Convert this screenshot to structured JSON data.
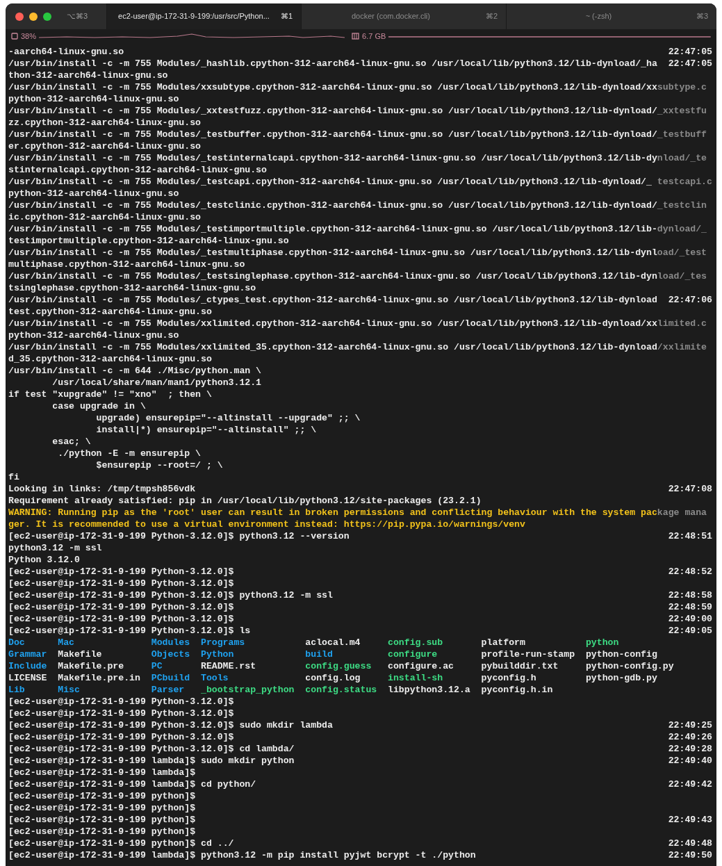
{
  "window": {
    "shortcut": "⌥⌘3"
  },
  "tabs": [
    {
      "label": "ec2-user@ip-172-31-9-199:/usr/src/Python...",
      "shortcut": "⌘1",
      "selected": true
    },
    {
      "label": "docker (com.docker.cli)",
      "shortcut": "⌘2",
      "selected": false
    },
    {
      "label": "~ (-zsh)",
      "shortcut": "⌘3",
      "selected": false
    }
  ],
  "status_bar": {
    "cpu": "38%",
    "memory": "6.7 GB"
  },
  "lines": [
    {
      "kind": "normal",
      "text": "-aarch64-linux-gnu.so",
      "time": "22:47:05"
    },
    {
      "kind": "normal",
      "text": "/usr/bin/install -c -m 755 Modules/_hashlib.cpython-312-aarch64-linux-gnu.so /usr/local/lib/python3.12/lib-dynload/_ha",
      "time": "22:47:05"
    },
    {
      "kind": "normal",
      "text": "thon-312-aarch64-linux-gnu.so"
    },
    {
      "kind": "normal",
      "text": "/usr/bin/install -c -m 755 Modules/xxsubtype.cpython-312-aarch64-linux-gnu.so /usr/local/lib/python3.12/lib-dynload/xx",
      "faded": "subtype.c"
    },
    {
      "kind": "normal",
      "text": "python-312-aarch64-linux-gnu.so"
    },
    {
      "kind": "normal",
      "text": "/usr/bin/install -c -m 755 Modules/_xxtestfuzz.cpython-312-aarch64-linux-gnu.so /usr/local/lib/python3.12/lib-dynload/",
      "faded": "_xxtestfu"
    },
    {
      "kind": "normal",
      "text": "zz.cpython-312-aarch64-linux-gnu.so"
    },
    {
      "kind": "normal",
      "text": "/usr/bin/install -c -m 755 Modules/_testbuffer.cpython-312-aarch64-linux-gnu.so /usr/local/lib/python3.12/lib-dynload/",
      "faded": "_testbuff"
    },
    {
      "kind": "normal",
      "text": "er.cpython-312-aarch64-linux-gnu.so"
    },
    {
      "kind": "normal",
      "text": "/usr/bin/install -c -m 755 Modules/_testinternalcapi.cpython-312-aarch64-linux-gnu.so /usr/local/lib/python3.12/lib-dy",
      "faded": "nload/_te"
    },
    {
      "kind": "normal",
      "text": "stinternalcapi.cpython-312-aarch64-linux-gnu.so"
    },
    {
      "kind": "normal",
      "text": "/usr/bin/install -c -m 755 Modules/_testcapi.cpython-312-aarch64-linux-gnu.so /usr/local/lib/python3.12/lib-dynload/_",
      "faded": "testcapi.c"
    },
    {
      "kind": "normal",
      "text": "python-312-aarch64-linux-gnu.so"
    },
    {
      "kind": "normal",
      "text": "/usr/bin/install -c -m 755 Modules/_testclinic.cpython-312-aarch64-linux-gnu.so /usr/local/lib/python3.12/lib-dynload/",
      "faded": "_testclin"
    },
    {
      "kind": "normal",
      "text": "ic.cpython-312-aarch64-linux-gnu.so"
    },
    {
      "kind": "normal",
      "text": "/usr/bin/install -c -m 755 Modules/_testimportmultiple.cpython-312-aarch64-linux-gnu.so /usr/local/lib/python3.12/lib-",
      "faded": "dynload/_"
    },
    {
      "kind": "normal",
      "text": "testimportmultiple.cpython-312-aarch64-linux-gnu.so"
    },
    {
      "kind": "normal",
      "text": "/usr/bin/install -c -m 755 Modules/_testmultiphase.cpython-312-aarch64-linux-gnu.so /usr/local/lib/python3.12/lib-dynl",
      "faded": "oad/_test"
    },
    {
      "kind": "normal",
      "text": "multiphase.cpython-312-aarch64-linux-gnu.so"
    },
    {
      "kind": "normal",
      "text": "/usr/bin/install -c -m 755 Modules/_testsinglephase.cpython-312-aarch64-linux-gnu.so /usr/local/lib/python3.12/lib-dyn",
      "faded": "load/_tes"
    },
    {
      "kind": "normal",
      "text": "tsinglephase.cpython-312-aarch64-linux-gnu.so"
    },
    {
      "kind": "normal",
      "text": "/usr/bin/install -c -m 755 Modules/_ctypes_test.cpython-312-aarch64-linux-gnu.so /usr/local/lib/python3.12/lib-dynload",
      "time": "22:47:06"
    },
    {
      "kind": "normal",
      "text": "test.cpython-312-aarch64-linux-gnu.so"
    },
    {
      "kind": "normal",
      "text": "/usr/bin/install -c -m 755 Modules/xxlimited.cpython-312-aarch64-linux-gnu.so /usr/local/lib/python3.12/lib-dynload/xx",
      "faded": "limited.c"
    },
    {
      "kind": "normal",
      "text": "python-312-aarch64-linux-gnu.so"
    },
    {
      "kind": "normal",
      "text": "/usr/bin/install -c -m 755 Modules/xxlimited_35.cpython-312-aarch64-linux-gnu.so /usr/local/lib/python3.12/lib-dynload",
      "faded": "/xxlimite"
    },
    {
      "kind": "normal",
      "text": "d_35.cpython-312-aarch64-linux-gnu.so"
    },
    {
      "kind": "normal",
      "text": "/usr/bin/install -c -m 644 ./Misc/python.man \\"
    },
    {
      "kind": "normal",
      "text": "        /usr/local/share/man/man1/python3.12.1"
    },
    {
      "kind": "normal",
      "text": "if test \"xupgrade\" != \"xno\"  ; then \\"
    },
    {
      "kind": "normal",
      "text": "        case upgrade in \\"
    },
    {
      "kind": "normal",
      "text": "                upgrade) ensurepip=\"--altinstall --upgrade\" ;; \\"
    },
    {
      "kind": "normal",
      "text": "                install|*) ensurepip=\"--altinstall\" ;; \\"
    },
    {
      "kind": "normal",
      "text": "        esac; \\"
    },
    {
      "kind": "normal",
      "text": "         ./python -E -m ensurepip \\"
    },
    {
      "kind": "normal",
      "text": "                $ensurepip --root=/ ; \\"
    },
    {
      "kind": "normal",
      "text": "fi"
    },
    {
      "kind": "normal",
      "text": "Looking in links: /tmp/tmpsh856vdk",
      "time": "22:47:08"
    },
    {
      "kind": "normal",
      "text": "Requirement already satisfied: pip in /usr/local/lib/python3.12/site-packages (23.2.1)"
    },
    {
      "kind": "warning",
      "text": "WARNING: Running pip as the 'root' user can result in broken permissions and conflicting behaviour with the system pac",
      "faded": "kage mana"
    },
    {
      "kind": "warning",
      "text": "ger. It is recommended to use a virtual environment instead: https://pip.pypa.io/warnings/venv"
    },
    {
      "kind": "normal",
      "text": "[ec2-user@ip-172-31-9-199 Python-3.12.0]$ python3.12 --version",
      "time": "22:48:51"
    },
    {
      "kind": "normal",
      "text": "python3.12 -m ssl"
    },
    {
      "kind": "normal",
      "text": "Python 3.12.0"
    },
    {
      "kind": "normal",
      "text": "[ec2-user@ip-172-31-9-199 Python-3.12.0]$",
      "time": "22:48:52"
    },
    {
      "kind": "normal",
      "text": "[ec2-user@ip-172-31-9-199 Python-3.12.0]$"
    },
    {
      "kind": "normal",
      "text": "[ec2-user@ip-172-31-9-199 Python-3.12.0]$ python3.12 -m ssl",
      "time": "22:48:58"
    },
    {
      "kind": "normal",
      "text": "[ec2-user@ip-172-31-9-199 Python-3.12.0]$",
      "time": "22:48:59"
    },
    {
      "kind": "normal",
      "text": "[ec2-user@ip-172-31-9-199 Python-3.12.0]$",
      "time": "22:49:00"
    },
    {
      "kind": "normal",
      "text": "[ec2-user@ip-172-31-9-199 Python-3.12.0]$ ls",
      "time": "22:49:05"
    },
    {
      "kind": "ls",
      "entries": [
        {
          "name": "Doc",
          "kind": "dir"
        },
        {
          "name": "Mac",
          "kind": "dir"
        },
        {
          "name": "Modules",
          "kind": "dir"
        },
        {
          "name": "Programs",
          "kind": "dir"
        },
        {
          "name": "aclocal.m4",
          "kind": "file"
        },
        {
          "name": "config.sub",
          "kind": "exec"
        },
        {
          "name": "platform",
          "kind": "file"
        },
        {
          "name": "python",
          "kind": "exec"
        }
      ]
    },
    {
      "kind": "ls",
      "entries": [
        {
          "name": "Grammar",
          "kind": "dir"
        },
        {
          "name": "Makefile",
          "kind": "file"
        },
        {
          "name": "Objects",
          "kind": "dir"
        },
        {
          "name": "Python",
          "kind": "dir"
        },
        {
          "name": "build",
          "kind": "dir"
        },
        {
          "name": "configure",
          "kind": "exec"
        },
        {
          "name": "profile-run-stamp",
          "kind": "file"
        },
        {
          "name": "python-config",
          "kind": "file"
        }
      ]
    },
    {
      "kind": "ls",
      "entries": [
        {
          "name": "Include",
          "kind": "dir"
        },
        {
          "name": "Makefile.pre",
          "kind": "file"
        },
        {
          "name": "PC",
          "kind": "dir"
        },
        {
          "name": "README.rst",
          "kind": "file"
        },
        {
          "name": "config.guess",
          "kind": "exec"
        },
        {
          "name": "configure.ac",
          "kind": "file"
        },
        {
          "name": "pybuilddir.txt",
          "kind": "file"
        },
        {
          "name": "python-config.py",
          "kind": "file"
        }
      ]
    },
    {
      "kind": "ls",
      "entries": [
        {
          "name": "LICENSE",
          "kind": "file"
        },
        {
          "name": "Makefile.pre.in",
          "kind": "file"
        },
        {
          "name": "PCbuild",
          "kind": "dir"
        },
        {
          "name": "Tools",
          "kind": "dir"
        },
        {
          "name": "config.log",
          "kind": "file"
        },
        {
          "name": "install-sh",
          "kind": "exec"
        },
        {
          "name": "pyconfig.h",
          "kind": "file"
        },
        {
          "name": "python-gdb.py",
          "kind": "file"
        }
      ]
    },
    {
      "kind": "ls",
      "entries": [
        {
          "name": "Lib",
          "kind": "dir"
        },
        {
          "name": "Misc",
          "kind": "dir"
        },
        {
          "name": "Parser",
          "kind": "dir"
        },
        {
          "name": "_bootstrap_python",
          "kind": "exec"
        },
        {
          "name": "config.status",
          "kind": "exec"
        },
        {
          "name": "libpython3.12.a",
          "kind": "file"
        },
        {
          "name": "pyconfig.h.in",
          "kind": "file"
        }
      ]
    },
    {
      "kind": "normal",
      "text": "[ec2-user@ip-172-31-9-199 Python-3.12.0]$"
    },
    {
      "kind": "normal",
      "text": "[ec2-user@ip-172-31-9-199 Python-3.12.0]$"
    },
    {
      "kind": "normal",
      "text": "[ec2-user@ip-172-31-9-199 Python-3.12.0]$ sudo mkdir lambda",
      "time": "22:49:25"
    },
    {
      "kind": "normal",
      "text": "[ec2-user@ip-172-31-9-199 Python-3.12.0]$",
      "time": "22:49:26"
    },
    {
      "kind": "normal",
      "text": "[ec2-user@ip-172-31-9-199 Python-3.12.0]$ cd lambda/",
      "time": "22:49:28"
    },
    {
      "kind": "normal",
      "text": "[ec2-user@ip-172-31-9-199 lambda]$ sudo mkdir python",
      "time": "22:49:40"
    },
    {
      "kind": "normal",
      "text": "[ec2-user@ip-172-31-9-199 lambda]$"
    },
    {
      "kind": "normal",
      "text": "[ec2-user@ip-172-31-9-199 lambda]$ cd python/",
      "time": "22:49:42"
    },
    {
      "kind": "normal",
      "text": "[ec2-user@ip-172-31-9-199 python]$"
    },
    {
      "kind": "normal",
      "text": "[ec2-user@ip-172-31-9-199 python]$"
    },
    {
      "kind": "normal",
      "text": "[ec2-user@ip-172-31-9-199 python]$",
      "time": "22:49:43"
    },
    {
      "kind": "normal",
      "text": "[ec2-user@ip-172-31-9-199 python]$"
    },
    {
      "kind": "normal",
      "text": "[ec2-user@ip-172-31-9-199 python]$ cd ../",
      "time": "22:49:48"
    },
    {
      "kind": "normal",
      "text": "[ec2-user@ip-172-31-9-199 lambda]$ python3.12 -m pip install pyjwt bcrypt -t ./python",
      "time": "22:49:50"
    }
  ]
}
